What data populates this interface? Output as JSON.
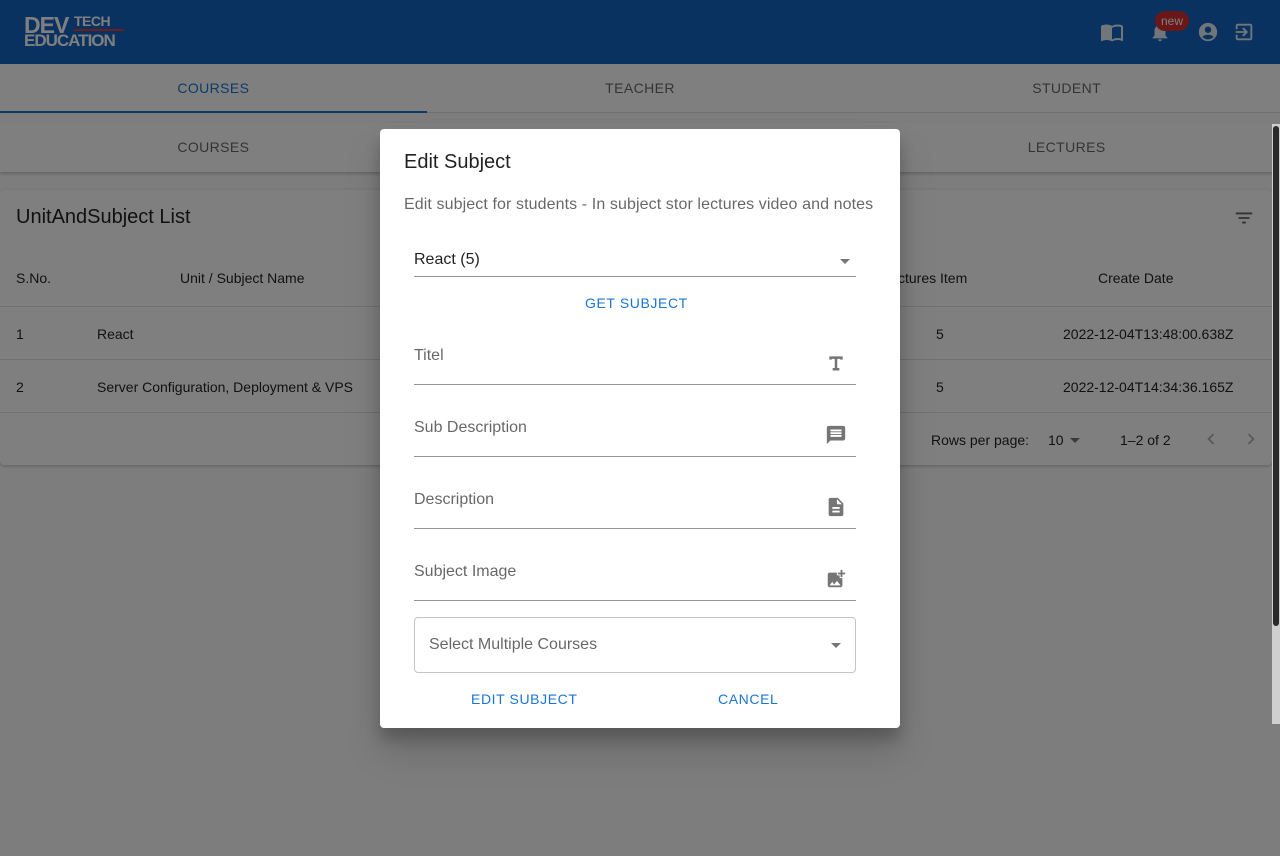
{
  "app": {
    "logo_text_1": "DEV",
    "logo_text_2": "TECH",
    "logo_text_3": "EDUCATION",
    "notification_badge": "new",
    "icons": [
      "book-open-icon",
      "bell-icon",
      "account-circle-icon",
      "logout-icon"
    ],
    "brand_color": "#1565c0",
    "accent_color": "#1976d2"
  },
  "tabs_primary": [
    {
      "label": "COURSES",
      "active": true
    },
    {
      "label": "TEACHER",
      "active": false
    },
    {
      "label": "STUDENT",
      "active": false
    }
  ],
  "tabs_secondary": [
    {
      "label": "COURSES"
    },
    {
      "label": ""
    },
    {
      "label": "LECTURES"
    }
  ],
  "list": {
    "title": "UnitAndSubject List",
    "columns": [
      "S.No.",
      "Unit / Subject Name",
      "ctures Item",
      "Create Date"
    ],
    "rows": [
      {
        "sno": "1",
        "name": "React",
        "lectures": "5",
        "date": "2022-12-04T13:48:00.638Z"
      },
      {
        "sno": "2",
        "name": "Server Configuration, Deployment & VPS",
        "lectures": "5",
        "date": "2022-12-04T14:34:36.165Z"
      }
    ],
    "pagination": {
      "rows_per_page_label": "Rows per page:",
      "rows_per_page": "10",
      "range": "1–2 of 2"
    }
  },
  "dialog": {
    "title": "Edit Subject",
    "description": "Edit subject for students - In subject stor lectures video and notes",
    "selected_subject": "React (5)",
    "get_subject_label": "GET SUBJECT",
    "fields": {
      "title_label": "Titel",
      "sub_description_label": "Sub Description",
      "description_label": "Description",
      "subject_image_label": "Subject Image"
    },
    "courses_select_label": "Select Multiple Courses",
    "edit_button_label": "EDIT SUBJECT",
    "cancel_button_label": "CANCEL"
  }
}
